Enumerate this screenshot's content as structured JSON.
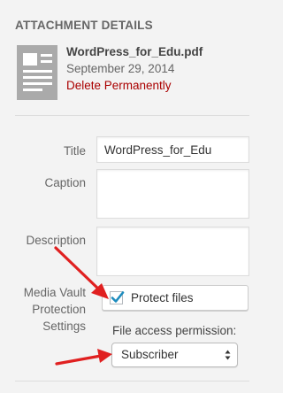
{
  "panel": {
    "heading": "ATTACHMENT DETAILS"
  },
  "file": {
    "icon": "document-icon",
    "name": "WordPress_for_Edu.pdf",
    "date": "September 29, 2014",
    "delete_label": "Delete Permanently"
  },
  "fields": {
    "title_label": "Title",
    "title_value": "WordPress_for_Edu",
    "caption_label": "Caption",
    "caption_value": "",
    "description_label": "Description",
    "description_value": ""
  },
  "media_vault": {
    "label_line1": "Media Vault",
    "label_line2": "Protection",
    "label_line3": "Settings",
    "protect_label": "Protect files",
    "protect_checked": true,
    "permission_label": "File access permission:",
    "permission_value": "Subscriber"
  },
  "colors": {
    "background": "#f3f3f3",
    "delete_link": "#aa0000",
    "checkmark": "#1e8cbe",
    "annotation_arrow": "#e02020"
  }
}
